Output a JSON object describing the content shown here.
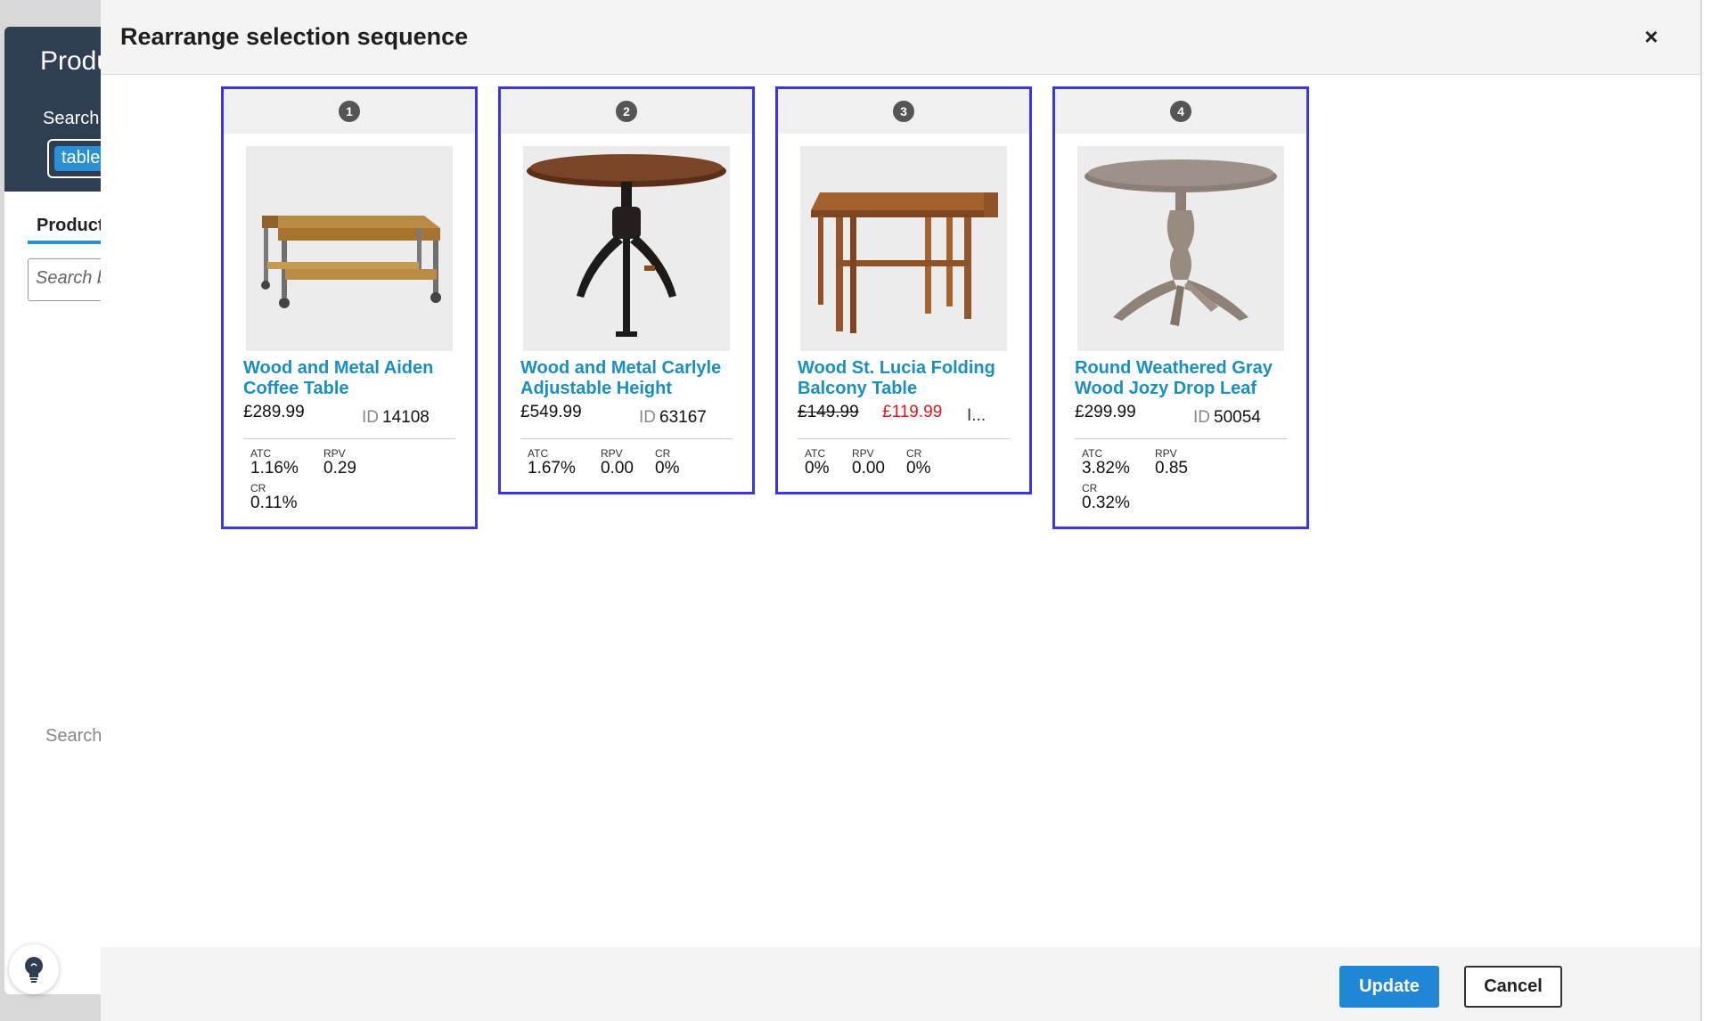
{
  "background": {
    "title": "Produ",
    "search_label": "Search",
    "chip": "table",
    "tab": "Product",
    "search_placeholder": "Search b",
    "empty_text": "Search"
  },
  "modal": {
    "title": "Rearrange selection sequence",
    "close_label": "×",
    "update_label": "Update",
    "cancel_label": "Cancel"
  },
  "products": [
    {
      "position": "1",
      "name": "Wood and Metal Aiden Coffee Table",
      "price": "£289.99",
      "id_label": "ID",
      "id": "14108",
      "metrics": [
        {
          "key": "ATC",
          "value": "1.16%"
        },
        {
          "key": "RPV",
          "value": "0.29"
        },
        {
          "key": "CR",
          "value": "0.11%"
        }
      ]
    },
    {
      "position": "2",
      "name": "Wood and Metal Carlyle Adjustable Height",
      "price": "£549.99",
      "id_label": "ID",
      "id": "63167",
      "metrics": [
        {
          "key": "ATC",
          "value": "1.67%"
        },
        {
          "key": "RPV",
          "value": "0.00"
        },
        {
          "key": "CR",
          "value": "0%"
        }
      ]
    },
    {
      "position": "3",
      "name": "Wood St. Lucia Folding Balcony Table",
      "old_price": "£149.99",
      "sale_price": "£119.99",
      "more": "I...",
      "metrics": [
        {
          "key": "ATC",
          "value": "0%"
        },
        {
          "key": "RPV",
          "value": "0.00"
        },
        {
          "key": "CR",
          "value": "0%"
        }
      ]
    },
    {
      "position": "4",
      "name": "Round Weathered Gray Wood Jozy Drop Leaf",
      "price": "£299.99",
      "id_label": "ID",
      "id": "50054",
      "metrics": [
        {
          "key": "ATC",
          "value": "3.82%"
        },
        {
          "key": "RPV",
          "value": "0.85"
        },
        {
          "key": "CR",
          "value": "0.32%"
        }
      ]
    }
  ],
  "colors": {
    "card_border": "#3b35e6",
    "product_link": "#1a8fc3",
    "sale_price": "#e8141e",
    "primary_button": "#1f87d6"
  },
  "icons": {
    "close": "close-icon",
    "hint": "lightbulb-icon"
  }
}
